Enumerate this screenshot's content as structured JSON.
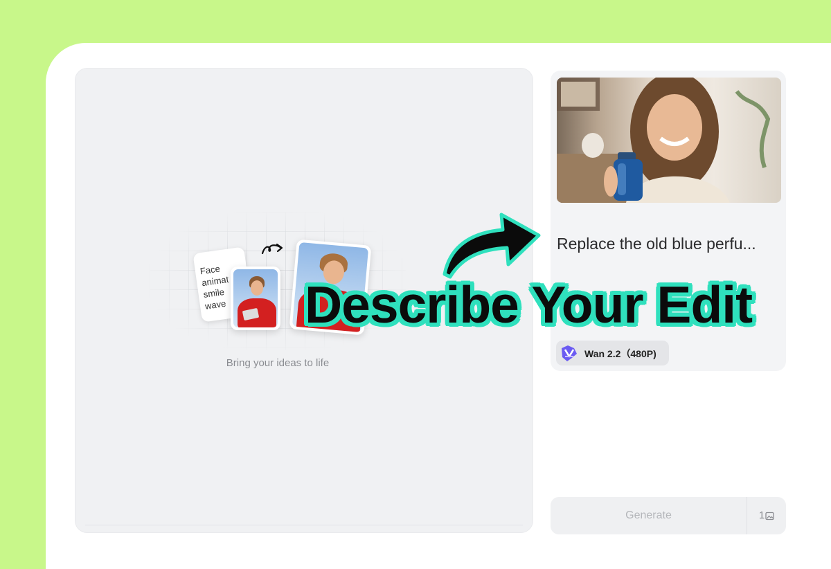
{
  "canvas": {
    "preview_card_lines": [
      "Face",
      "animat",
      "smile",
      "wave"
    ],
    "hint": "Bring your ideas to life"
  },
  "sidebar": {
    "hero_image": "woman holding blue perfume bottle",
    "prompt_text": "Replace the old blue perfu...",
    "model": {
      "icon": "wan-model-logo-icon",
      "label": "Wan 2.2（480P)"
    }
  },
  "footer": {
    "generate_label": "Generate",
    "count_label": "1",
    "count_icon": "image-icon"
  },
  "overlay": {
    "title": "Describe Your Edit"
  },
  "colors": {
    "background": "#c8f78a",
    "accent_outline": "#2fe0bd",
    "panel": "#ffffff"
  }
}
